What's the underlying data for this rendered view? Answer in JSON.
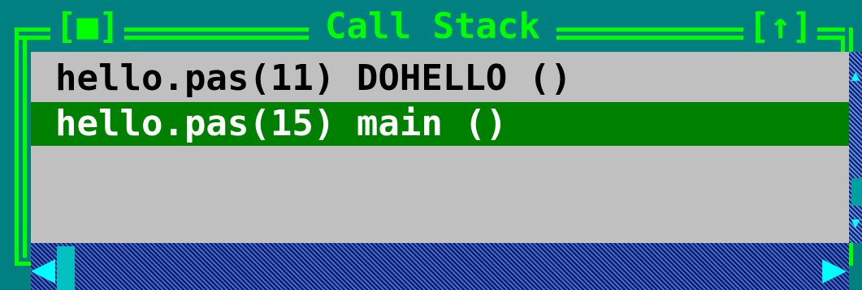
{
  "window": {
    "title": "Call Stack",
    "close_box": "[■]",
    "zoom_box": "[↑]"
  },
  "stack": {
    "rows": [
      {
        "text": "hello.pas(11) DOHELLO ()"
      },
      {
        "text": "hello.pas(15) main ()",
        "selected": true
      }
    ]
  },
  "scrollbars": {
    "vertical": {
      "up_icon": "▲",
      "down_icon": "▼"
    },
    "horizontal": {
      "left_icon": "◀",
      "right_icon": "▶"
    }
  },
  "colors": {
    "background": "#008080",
    "frame": "#00ff00",
    "list_background": "#c0c0c0",
    "selected_row": "#008000",
    "selected_text": "#ffffff",
    "scrollbar": "#2040a0"
  }
}
